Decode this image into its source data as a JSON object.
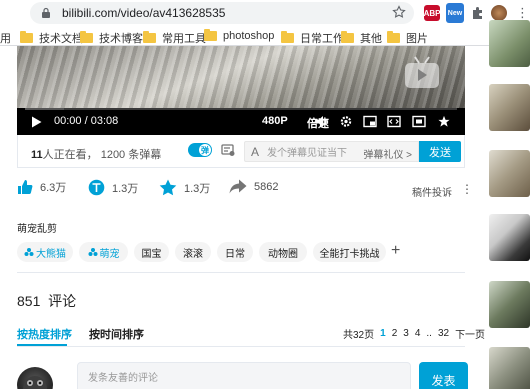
{
  "browser": {
    "url": "bilibili.com/video/av413628535",
    "extensions": [
      {
        "name": "abp-icon",
        "label": "ABP",
        "color": "#c70d2c"
      },
      {
        "name": "new-badge-icon",
        "label": "New",
        "color": "#2a7ad5"
      },
      {
        "name": "puzzle-icon",
        "label": "",
        "color": "#5f6368"
      },
      {
        "name": "profile-icon",
        "label": "",
        "color": "#8a5a3b"
      }
    ],
    "bookmarks": [
      {
        "label": "用"
      },
      {
        "label": "技术文档"
      },
      {
        "label": "技术博客"
      },
      {
        "label": "常用工具"
      },
      {
        "label": "photoshop"
      },
      {
        "label": "日常工作"
      },
      {
        "label": "其他"
      },
      {
        "label": "图片"
      }
    ]
  },
  "player": {
    "current_time": "00:00",
    "duration": "03:08",
    "time_separator": "/",
    "quality": "480P",
    "speed": "倍速",
    "progress_fraction": 0.09
  },
  "danmaku": {
    "viewers_count": "11",
    "viewers_text": "人正在看，",
    "danmaku_count": "1200 条弹幕",
    "toggle_label": "弹",
    "input_icon": "A",
    "placeholder": "发个弹幕见证当下",
    "etiquette": "弹幕礼仪 >",
    "send_label": "发送"
  },
  "actions": {
    "like": "6.3万",
    "coin": "1.3万",
    "favorite": "1.3万",
    "share": "5862",
    "report": "稿件投诉",
    "more": "⋮"
  },
  "section": {
    "title": "萌宠乱剪"
  },
  "tags": [
    {
      "label": "大熊猫",
      "highlight": true
    },
    {
      "label": "萌宠",
      "highlight": true
    },
    {
      "label": "国宝",
      "highlight": false
    },
    {
      "label": "滚滚",
      "highlight": false
    },
    {
      "label": "日常",
      "highlight": false
    },
    {
      "label": "动物圈",
      "highlight": false
    },
    {
      "label": "全能打卡挑战",
      "highlight": false
    }
  ],
  "comments": {
    "count": "851",
    "count_label": "评论",
    "sort_hot": "按热度排序",
    "sort_time": "按时间排序",
    "pager": {
      "total": "共32页",
      "pages": [
        "1",
        "2",
        "3",
        "4",
        "..",
        "32"
      ],
      "next": "下一页"
    },
    "placeholder": "发条友善的评论",
    "post_label": "发表"
  },
  "colors": {
    "accent": "#00a1d6"
  }
}
